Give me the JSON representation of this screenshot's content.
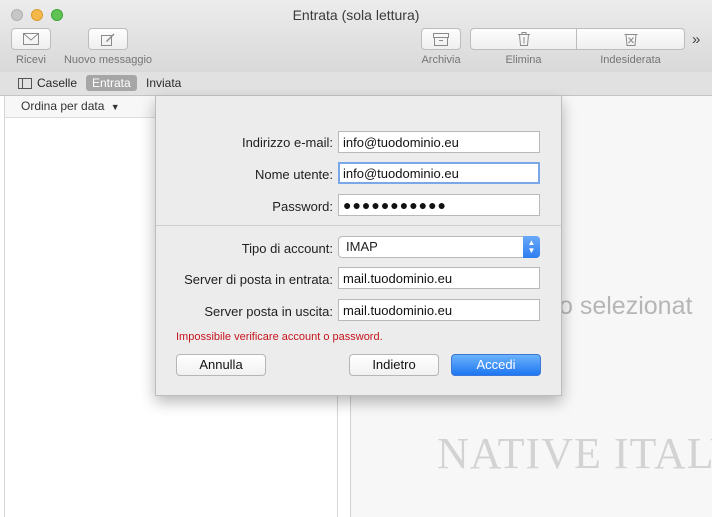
{
  "window": {
    "title": "Entrata (sola lettura)"
  },
  "toolbar": {
    "ricevi": "Ricevi",
    "nuovo_messaggio": "Nuovo messaggio",
    "archivia": "Archivia",
    "elimina": "Elimina",
    "indesiderata": "Indesiderata",
    "more": "»"
  },
  "favorites": {
    "caselle": "Caselle",
    "entrata": "Entrata",
    "inviata": "Inviata"
  },
  "list": {
    "sort_label": "Ordina per data"
  },
  "viewer": {
    "placeholder": "o selezionat",
    "watermark": "NATIVE ITALY"
  },
  "dialog": {
    "email_label": "Indirizzo e-mail:",
    "email_value": "info@tuodominio.eu",
    "username_label": "Nome utente:",
    "username_value": "info@tuodominio.eu",
    "password_label": "Password:",
    "password_value": "●●●●●●●●●●●",
    "account_type_label": "Tipo di account:",
    "account_type_value": "IMAP",
    "incoming_label": "Server di posta in entrata:",
    "incoming_value": "mail.tuodominio.eu",
    "outgoing_label": "Server posta in uscita:",
    "outgoing_value": "mail.tuodominio.eu",
    "error": "Impossibile verificare account o password.",
    "cancel_label": "Annulla",
    "back_label": "Indietro",
    "login_label": "Accedi"
  },
  "colors": {
    "accent": "#1d76f2",
    "error": "#c5141e",
    "close_button": "#c7c7c7",
    "minimize_button": "#f5b94a",
    "maximize_button": "#5fc453"
  }
}
